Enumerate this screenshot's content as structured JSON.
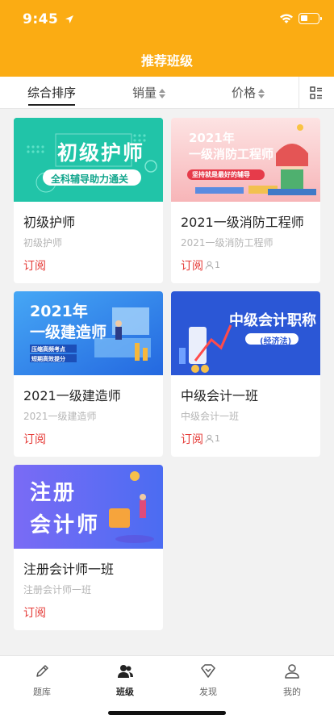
{
  "status_bar": {
    "time": "9:45"
  },
  "header": {
    "title": "推荐班级"
  },
  "sort_bar": {
    "items": [
      {
        "label": "综合排序",
        "active": true
      },
      {
        "label": "销量",
        "active": false
      },
      {
        "label": "价格",
        "active": false
      }
    ]
  },
  "courses": [
    {
      "title": "初级护师",
      "subtitle": "初级护师",
      "subscribe_label": "订阅",
      "count": "",
      "banner": {
        "headline": "初级护师",
        "tagline": "全科辅导助力通关"
      }
    },
    {
      "title": "2021一级消防工程师",
      "subtitle": "2021一级消防工程师",
      "subscribe_label": "订阅",
      "count": "1",
      "banner": {
        "year": "2021年",
        "headline": "一级消防工程师",
        "tagline": "坚持就是最好的辅导"
      }
    },
    {
      "title": "2021一级建造师",
      "subtitle": "2021一级建造师",
      "subscribe_label": "订阅",
      "count": "",
      "banner": {
        "year": "2021年",
        "headline": "一级建造师",
        "tagline1": "压缩高频考点",
        "tagline2": "短期高效提分"
      }
    },
    {
      "title": "中级会计一班",
      "subtitle": "中级会计一班",
      "subscribe_label": "订阅",
      "count": "1",
      "banner": {
        "headline": "中级会计职称",
        "tagline": "(经济法)"
      }
    },
    {
      "title": "注册会计师一班",
      "subtitle": "注册会计师一班",
      "subscribe_label": "订阅",
      "count": "",
      "banner": {
        "line1": "注册",
        "line2": "会计师"
      }
    }
  ],
  "tabbar": {
    "items": [
      {
        "label": "题库",
        "icon": "pencil-icon",
        "active": false
      },
      {
        "label": "班级",
        "icon": "users-icon",
        "active": true
      },
      {
        "label": "发现",
        "icon": "diamond-icon",
        "active": false
      },
      {
        "label": "我的",
        "icon": "person-icon",
        "active": false
      }
    ]
  },
  "colors": {
    "header": "#fbac13",
    "accent_red": "#e53935",
    "background": "#f2f2f2"
  }
}
